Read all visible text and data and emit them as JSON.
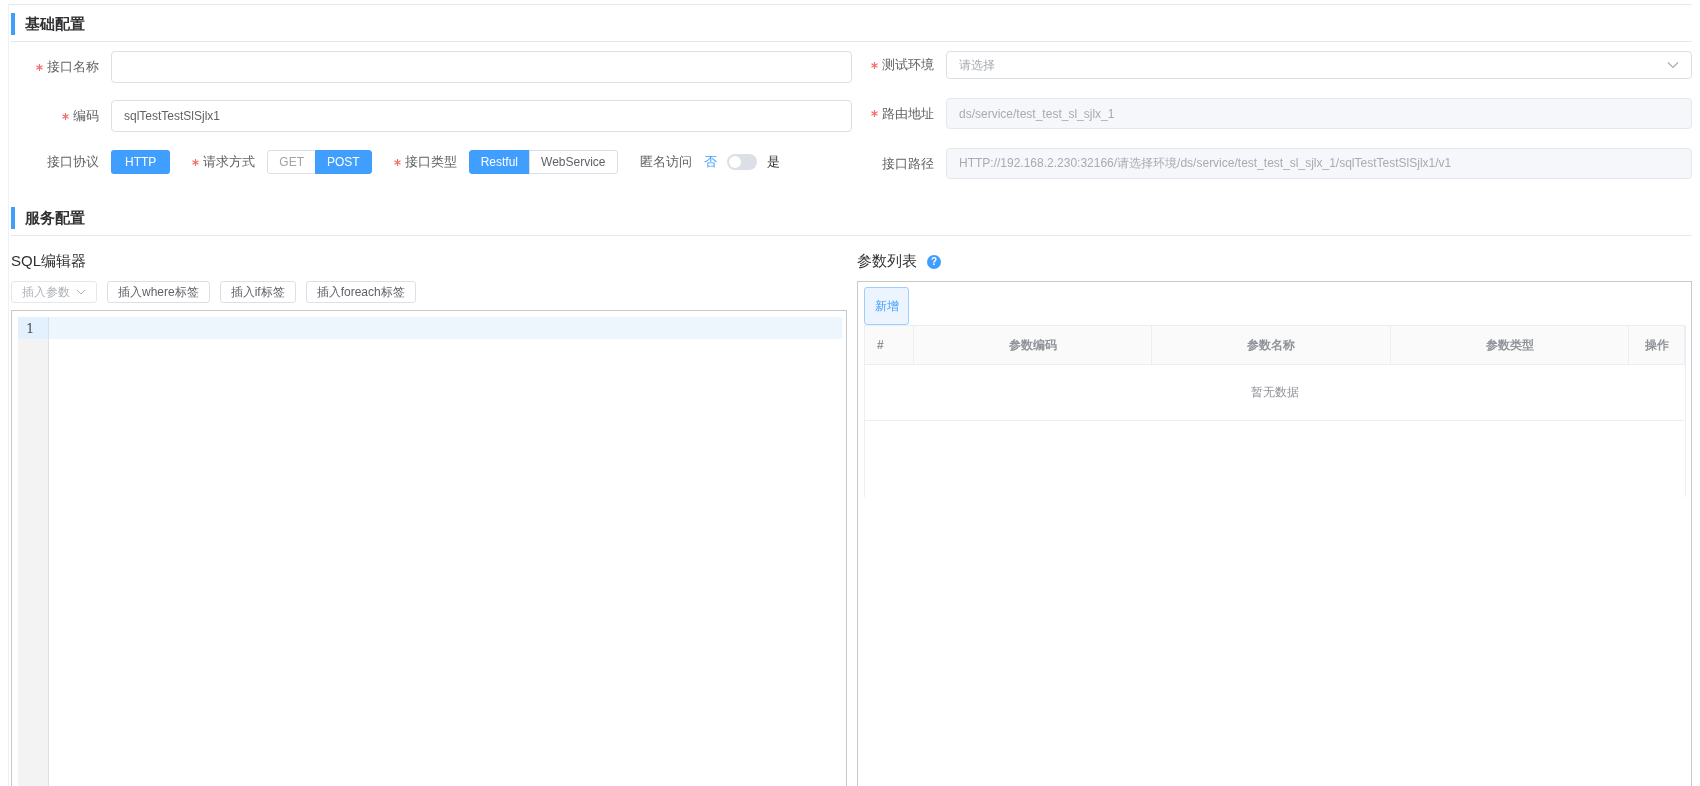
{
  "basic_config": {
    "title": "基础配置",
    "left_fields": [
      {
        "kind": "input",
        "label": "接口名称",
        "required": true
      },
      {
        "kind": "input",
        "label": "编码",
        "required": true,
        "value": "sqlTestTestSlSjlx1"
      }
    ],
    "right_fields": [
      {
        "kind": "select",
        "label": "测试环境",
        "required": true,
        "placeholder": "请选择"
      },
      {
        "kind": "readonly",
        "label": "路由地址",
        "required": true,
        "value": "ds/service/test_test_sl_sjlx_1"
      },
      {
        "kind": "readonly",
        "label": "接口路径",
        "required": false,
        "value": "HTTP://192.168.2.230:32166/请选择环境/ds/service/test_test_sl_sjlx_1/sqlTestTestSlSjlx1/v1"
      }
    ],
    "inline_fields": [
      {
        "kind": "tag",
        "label": "接口协议",
        "required": false,
        "value": "HTTP"
      },
      {
        "kind": "segmented",
        "label": "请求方式",
        "required": true,
        "options": [
          {
            "label": "GET",
            "selected": false
          },
          {
            "label": "POST",
            "selected": true
          }
        ]
      },
      {
        "kind": "segmented",
        "label": "接口类型",
        "required": true,
        "options": [
          {
            "label": "Restful",
            "selected": true
          },
          {
            "label": "WebService",
            "selected": false
          }
        ]
      },
      {
        "kind": "switch",
        "label": "匿名访问",
        "required": false,
        "off_label": "否",
        "on_label": "是",
        "on": false
      }
    ]
  },
  "service_config": {
    "title": "服务配置",
    "sql_editor": {
      "title": "SQL编辑器",
      "toolbar": [
        {
          "kind": "dropdown",
          "label": "插入参数",
          "disabled": true
        },
        {
          "kind": "button",
          "label": "插入where标签",
          "disabled": false
        },
        {
          "kind": "button",
          "label": "插入if标签",
          "disabled": false
        },
        {
          "kind": "button",
          "label": "插入foreach标签",
          "disabled": false
        }
      ],
      "lines": [
        {
          "number": "1",
          "active": true
        }
      ]
    },
    "param_list": {
      "title": "参数列表",
      "help_icon": "?",
      "add_button": "新增",
      "columns": [
        "#",
        "参数编码",
        "参数名称",
        "参数类型",
        "操作"
      ],
      "empty_text": "暂无数据"
    }
  }
}
